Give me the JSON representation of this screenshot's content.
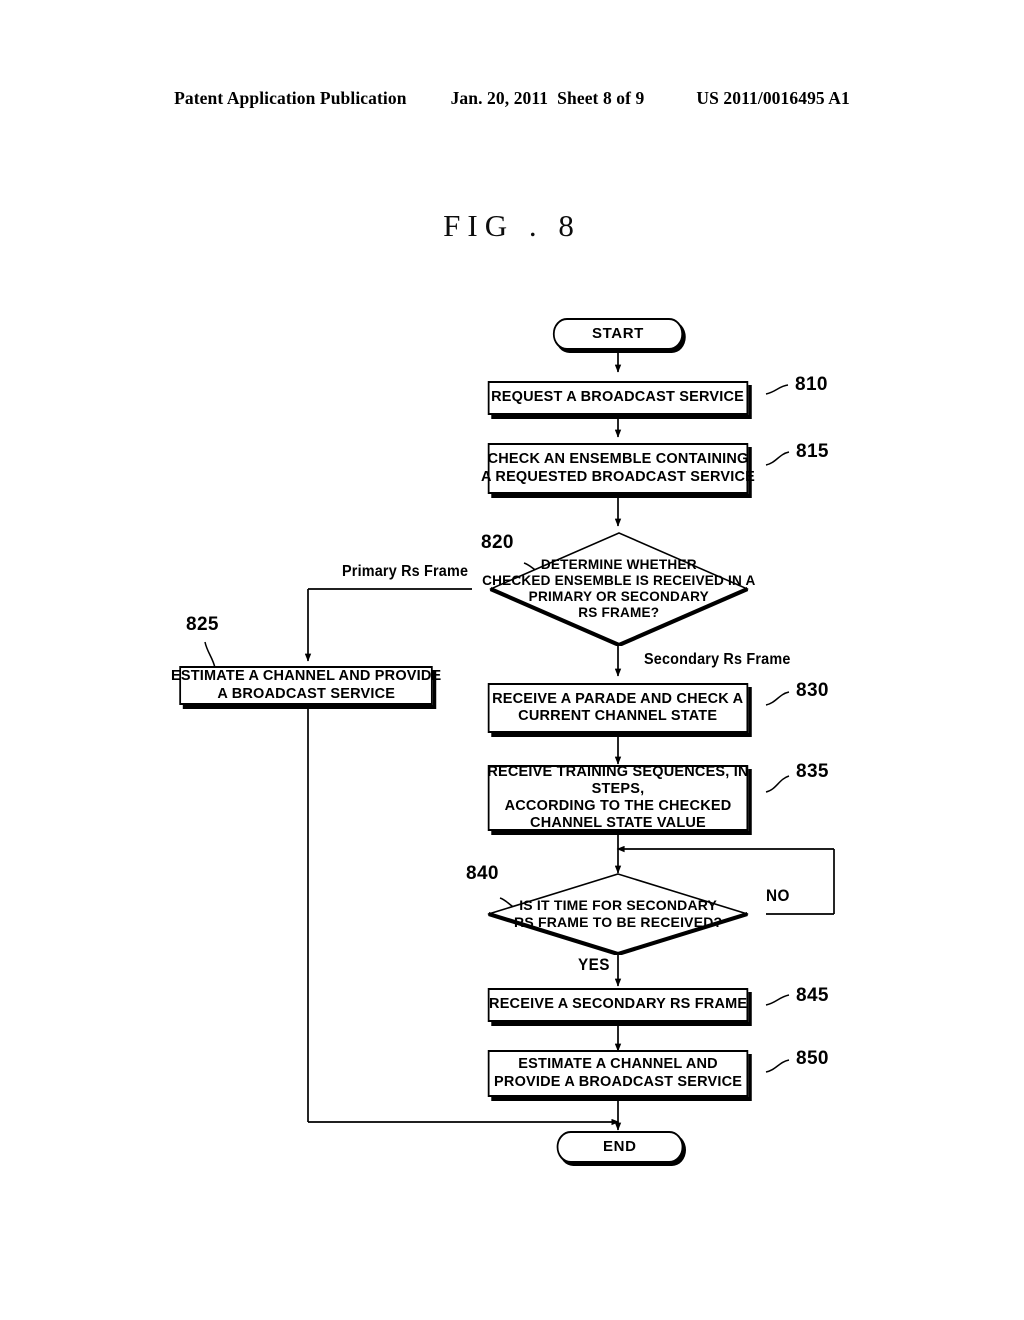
{
  "header": {
    "publication": "Patent Application Publication",
    "date": "Jan. 20, 2011",
    "sheet": "Sheet 8 of 9",
    "number": "US 2011/0016495 A1"
  },
  "figure": {
    "title": "FIG . 8"
  },
  "flowchart": {
    "nodes": {
      "start": {
        "label": "START",
        "ref": ""
      },
      "n810": {
        "line1": "REQUEST A BROADCAST SERVICE",
        "ref": "810"
      },
      "n815": {
        "line1": "CHECK AN ENSEMBLE CONTAINING",
        "line2": "A REQUESTED BROADCAST SERVICE",
        "ref": "815"
      },
      "n820": {
        "line1": "DETERMINE WHETHER",
        "line2": "CHECKED ENSEMBLE IS RECEIVED IN A",
        "line3": "PRIMARY OR SECONDARY",
        "line4": "RS FRAME?",
        "ref": "820"
      },
      "n825": {
        "line1": "ESTIMATE A CHANNEL AND PROVIDE",
        "line2": "A BROADCAST SERVICE",
        "ref": "825"
      },
      "n830": {
        "line1": "RECEIVE A PARADE AND CHECK A",
        "line2": "CURRENT CHANNEL STATE",
        "ref": "830"
      },
      "n835": {
        "line1": "RECEIVE TRAINING SEQUENCES, IN STEPS,",
        "line2": "ACCORDING TO THE CHECKED",
        "line3": "CHANNEL STATE VALUE",
        "ref": "835"
      },
      "n840": {
        "line1": "IS IT TIME FOR SECONDARY",
        "line2": "RS FRAME TO BE RECEIVED?",
        "ref": "840"
      },
      "n845": {
        "line1": "RECEIVE A SECONDARY RS FRAME",
        "ref": "845"
      },
      "n850": {
        "line1": "ESTIMATE A CHANNEL AND",
        "line2": "PROVIDE A BROADCAST SERVICE",
        "ref": "850"
      },
      "end": {
        "label": "END",
        "ref": ""
      }
    },
    "edge_labels": {
      "primary_rs_frame": "Primary Rs Frame",
      "secondary_rs_frame": "Secondary Rs Frame",
      "no": "NO",
      "yes": "YES"
    }
  }
}
